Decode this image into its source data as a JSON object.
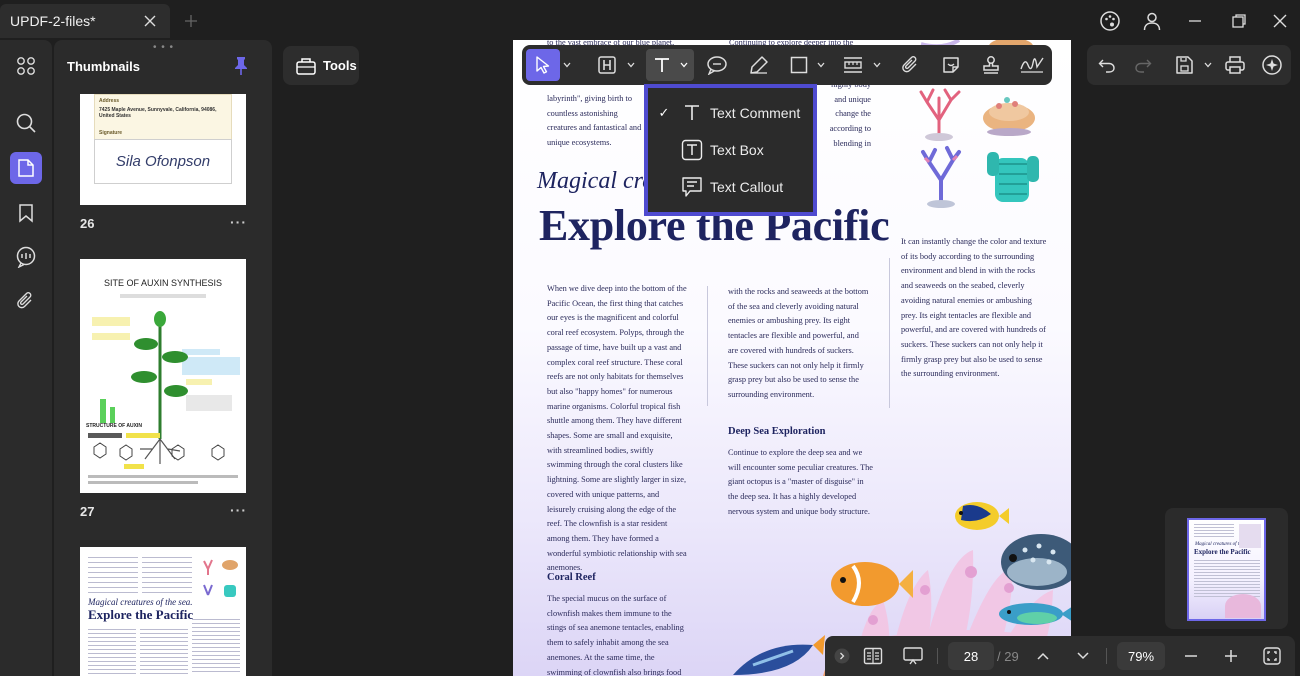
{
  "window": {
    "tab_title": "UPDF-2-files*"
  },
  "sidebar": {
    "title": "Thumbnails",
    "pages": [
      {
        "number": "26"
      },
      {
        "number": "27"
      },
      {
        "number": "28"
      }
    ],
    "thumb26": {
      "address_label": "Address",
      "address_value": "7425 Maple Avenue, Sunnyvale, California, 94086, United States",
      "signature_label": "Signature",
      "signature_value": "Sila Ofonpson"
    },
    "thumb27": {
      "title": "SITE OF AUXIN SYNTHESIS",
      "structure_label": "STRUCTURE OF AUXIN"
    },
    "thumb28": {
      "subtitle": "Magical creatures of the sea.",
      "title": "Explore the Pacific"
    }
  },
  "tools": {
    "label": "Tools"
  },
  "text_menu": {
    "items": [
      {
        "label": "Text Comment",
        "checked": true
      },
      {
        "label": "Text Box",
        "checked": false
      },
      {
        "label": "Text Callout",
        "checked": false
      }
    ]
  },
  "document": {
    "top_left_fragment": "to the vast embrace of our blue planet,",
    "top_mid_fragment": "Continuing to explore deeper into the",
    "intro_left": "labyrinth\", giving birth to countless astonishing creatures and fantastical and unique ecosystems.",
    "intro_right": "highly body and unique change the according to blending in",
    "subtitle": "Magical creatures of the sea.",
    "title": "Explore the Pacific",
    "col1": "When we dive deep into the bottom of the Pacific Ocean, the first thing that catches our eyes is the magnificent and colorful coral reef ecosystem. Polyps, through the passage of time, have built up a vast and complex coral reef structure. These coral reefs are not only habitats for themselves but also \"happy homes\" for numerous marine organisms. Colorful tropical fish shuttle among them. They have different shapes. Some are small and exquisite, with streamlined bodies, swiftly swimming through the coral clusters like lightning. Some are slightly larger in size, covered with unique patterns, and leisurely cruising along the edge of the reef. The clownfish is a star resident among them. They have formed a wonderful symbiotic relationship with sea anemones.",
    "coral_reef_heading": "Coral Reef",
    "coral_reef_text": "The special mucus on the surface of clownfish makes them immune to the stings of sea anemone tentacles, enabling them to safely inhabit among the sea anemones. At the same time, the swimming of clownfish also brings food to",
    "col2": "with the rocks and seaweeds at the bottom of the sea and cleverly avoiding natural enemies or ambushing prey. Its eight tentacles are flexible and powerful, and are covered with hundreds of suckers. These suckers can not only help it firmly grasp prey but also be used to sense the surrounding environment.",
    "deep_sea_heading": "Deep Sea Exploration",
    "deep_sea_text": "Continue to explore the deep sea and we will encounter some peculiar creatures. The giant octopus is a \"master of disguise\" in the deep sea. It has a highly developed nervous system and unique body structure.",
    "col3": "It can instantly change the color and texture of its body according to the surrounding environment and blend in with the rocks and seaweeds on the seabed, cleverly avoiding natural enemies or ambushing prey. Its eight tentacles are flexible and powerful, and are covered with hundreds of suckers. These suckers can not only help it firmly grasp prey but also be used to sense the surrounding environment."
  },
  "navigation": {
    "current_page": "28",
    "total_pages": "/ 29",
    "zoom": "79%"
  },
  "colors": {
    "accent": "#6d67e8",
    "menu_border": "#4f4bd0",
    "title_navy": "#1e2460"
  }
}
